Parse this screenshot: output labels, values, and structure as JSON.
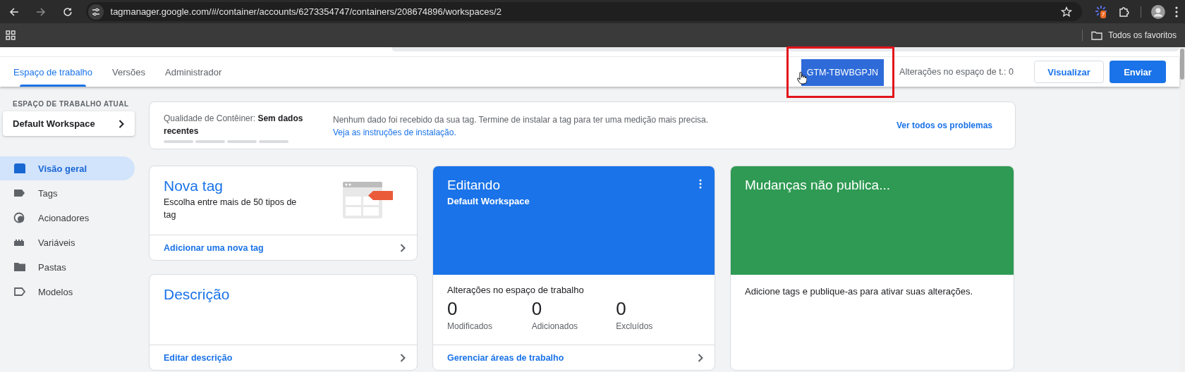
{
  "browser": {
    "address": "tagmanager.google.com/#/container/accounts/6273354747/containers/208674896/workspaces/2",
    "extension_badge": "7",
    "bookmarks_label": "Todos os favoritos"
  },
  "nav_tabs": [
    {
      "label": "Espaço de trabalho",
      "selected": true
    },
    {
      "label": "Versões",
      "selected": false
    },
    {
      "label": "Administrador",
      "selected": false
    }
  ],
  "header": {
    "container_id": "GTM-TBWBGPJN",
    "highlighted": true,
    "changes_text": "Alterações no espaço de t.: 0",
    "buttons": [
      {
        "label": "Visualizar",
        "kind": "outlined"
      },
      {
        "label": "Enviar",
        "kind": "filled"
      }
    ]
  },
  "sidebar": {
    "section_label": "ESPAÇO DE TRABALHO ATUAL",
    "workspace": "Default Workspace",
    "items": [
      {
        "label": "Visão geral",
        "kind": "overview",
        "selected": true
      },
      {
        "label": "Tags",
        "kind": "tag",
        "selected": false
      },
      {
        "label": "Acionadores",
        "kind": "trigger",
        "selected": false
      },
      {
        "label": "Variáveis",
        "kind": "variable",
        "selected": false
      },
      {
        "label": "Pastas",
        "kind": "folder",
        "selected": false
      },
      {
        "label": "Modelos",
        "kind": "template",
        "selected": false
      }
    ]
  },
  "quality": {
    "label": "Qualidade de Contêiner: **Sem dados recentes**",
    "message": "Nenhum dado foi recebido da sua tag. Termine de instalar a tag para ter uma medição mais precisa.",
    "link": "Veja as instruções de instalação.",
    "action": "Ver todos os problemas"
  },
  "new_tag_card": {
    "title": "Nova tag",
    "subtitle": "Escolha entre mais de 50 tipos de tag",
    "link": "Adicionar uma nova tag"
  },
  "description_card": {
    "title": "Descrição",
    "link": "Editar descrição"
  },
  "editing_card": {
    "title": "Editando",
    "subtitle": "Default Workspace",
    "stats_title": "Alterações no espaço de trabalho",
    "stats": [
      {
        "value": "0",
        "label": "Modificados"
      },
      {
        "value": "0",
        "label": "Adicionados"
      },
      {
        "value": "0",
        "label": "Excluídos"
      }
    ],
    "link": "Gerenciar áreas de trabalho"
  },
  "unpublished_card": {
    "title": "Mudanças não publica...",
    "text": "Adicione tags e publique-as para ativar suas alterações."
  }
}
